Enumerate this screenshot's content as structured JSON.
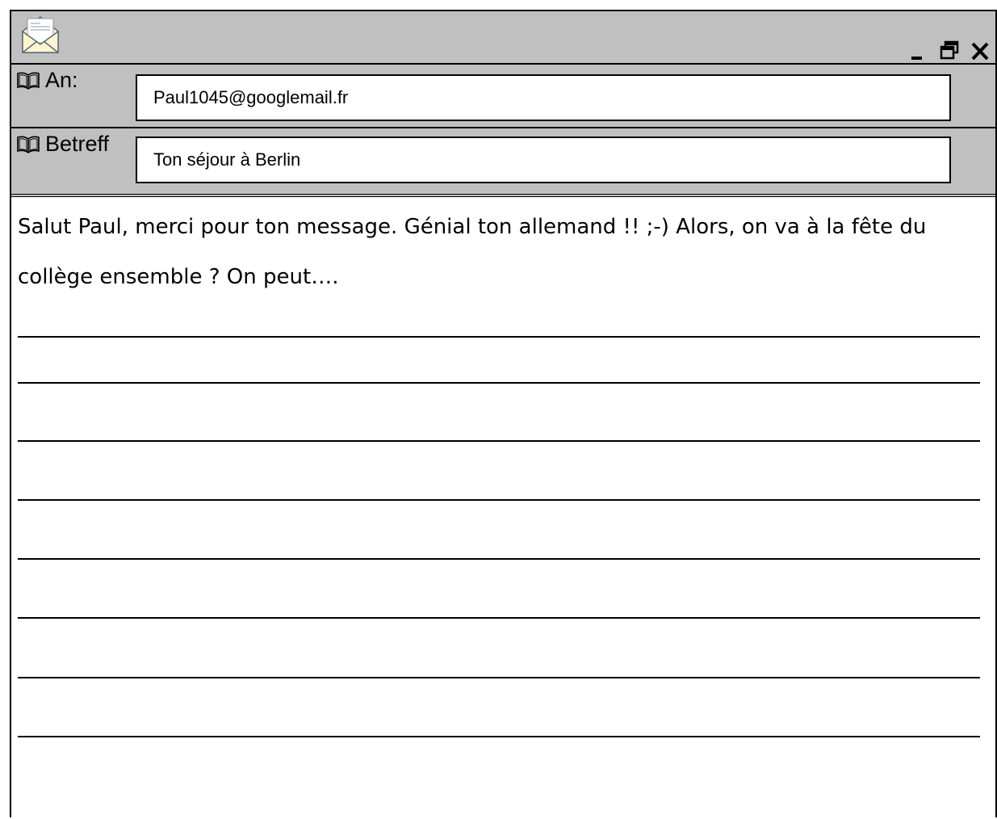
{
  "window": {
    "icon": "envelope-icon",
    "controls": [
      "minimize-icon",
      "restore-icon",
      "close-icon"
    ]
  },
  "header": {
    "to_label": "An:",
    "to_value": "Paul1045@googlemail.fr",
    "subject_label": "Betreff",
    "subject_value": "Ton séjour à Berlin",
    "label_icon": "open-book-icon"
  },
  "message": {
    "line1": "Salut Paul, merci pour ton message. Génial ton allemand !! ;-) Alors, on va à la fête du",
    "line2": "collège ensemble ? On peut…."
  },
  "colors": {
    "chrome": "#c0c0c0",
    "border": "#000000",
    "body": "#ffffff"
  }
}
